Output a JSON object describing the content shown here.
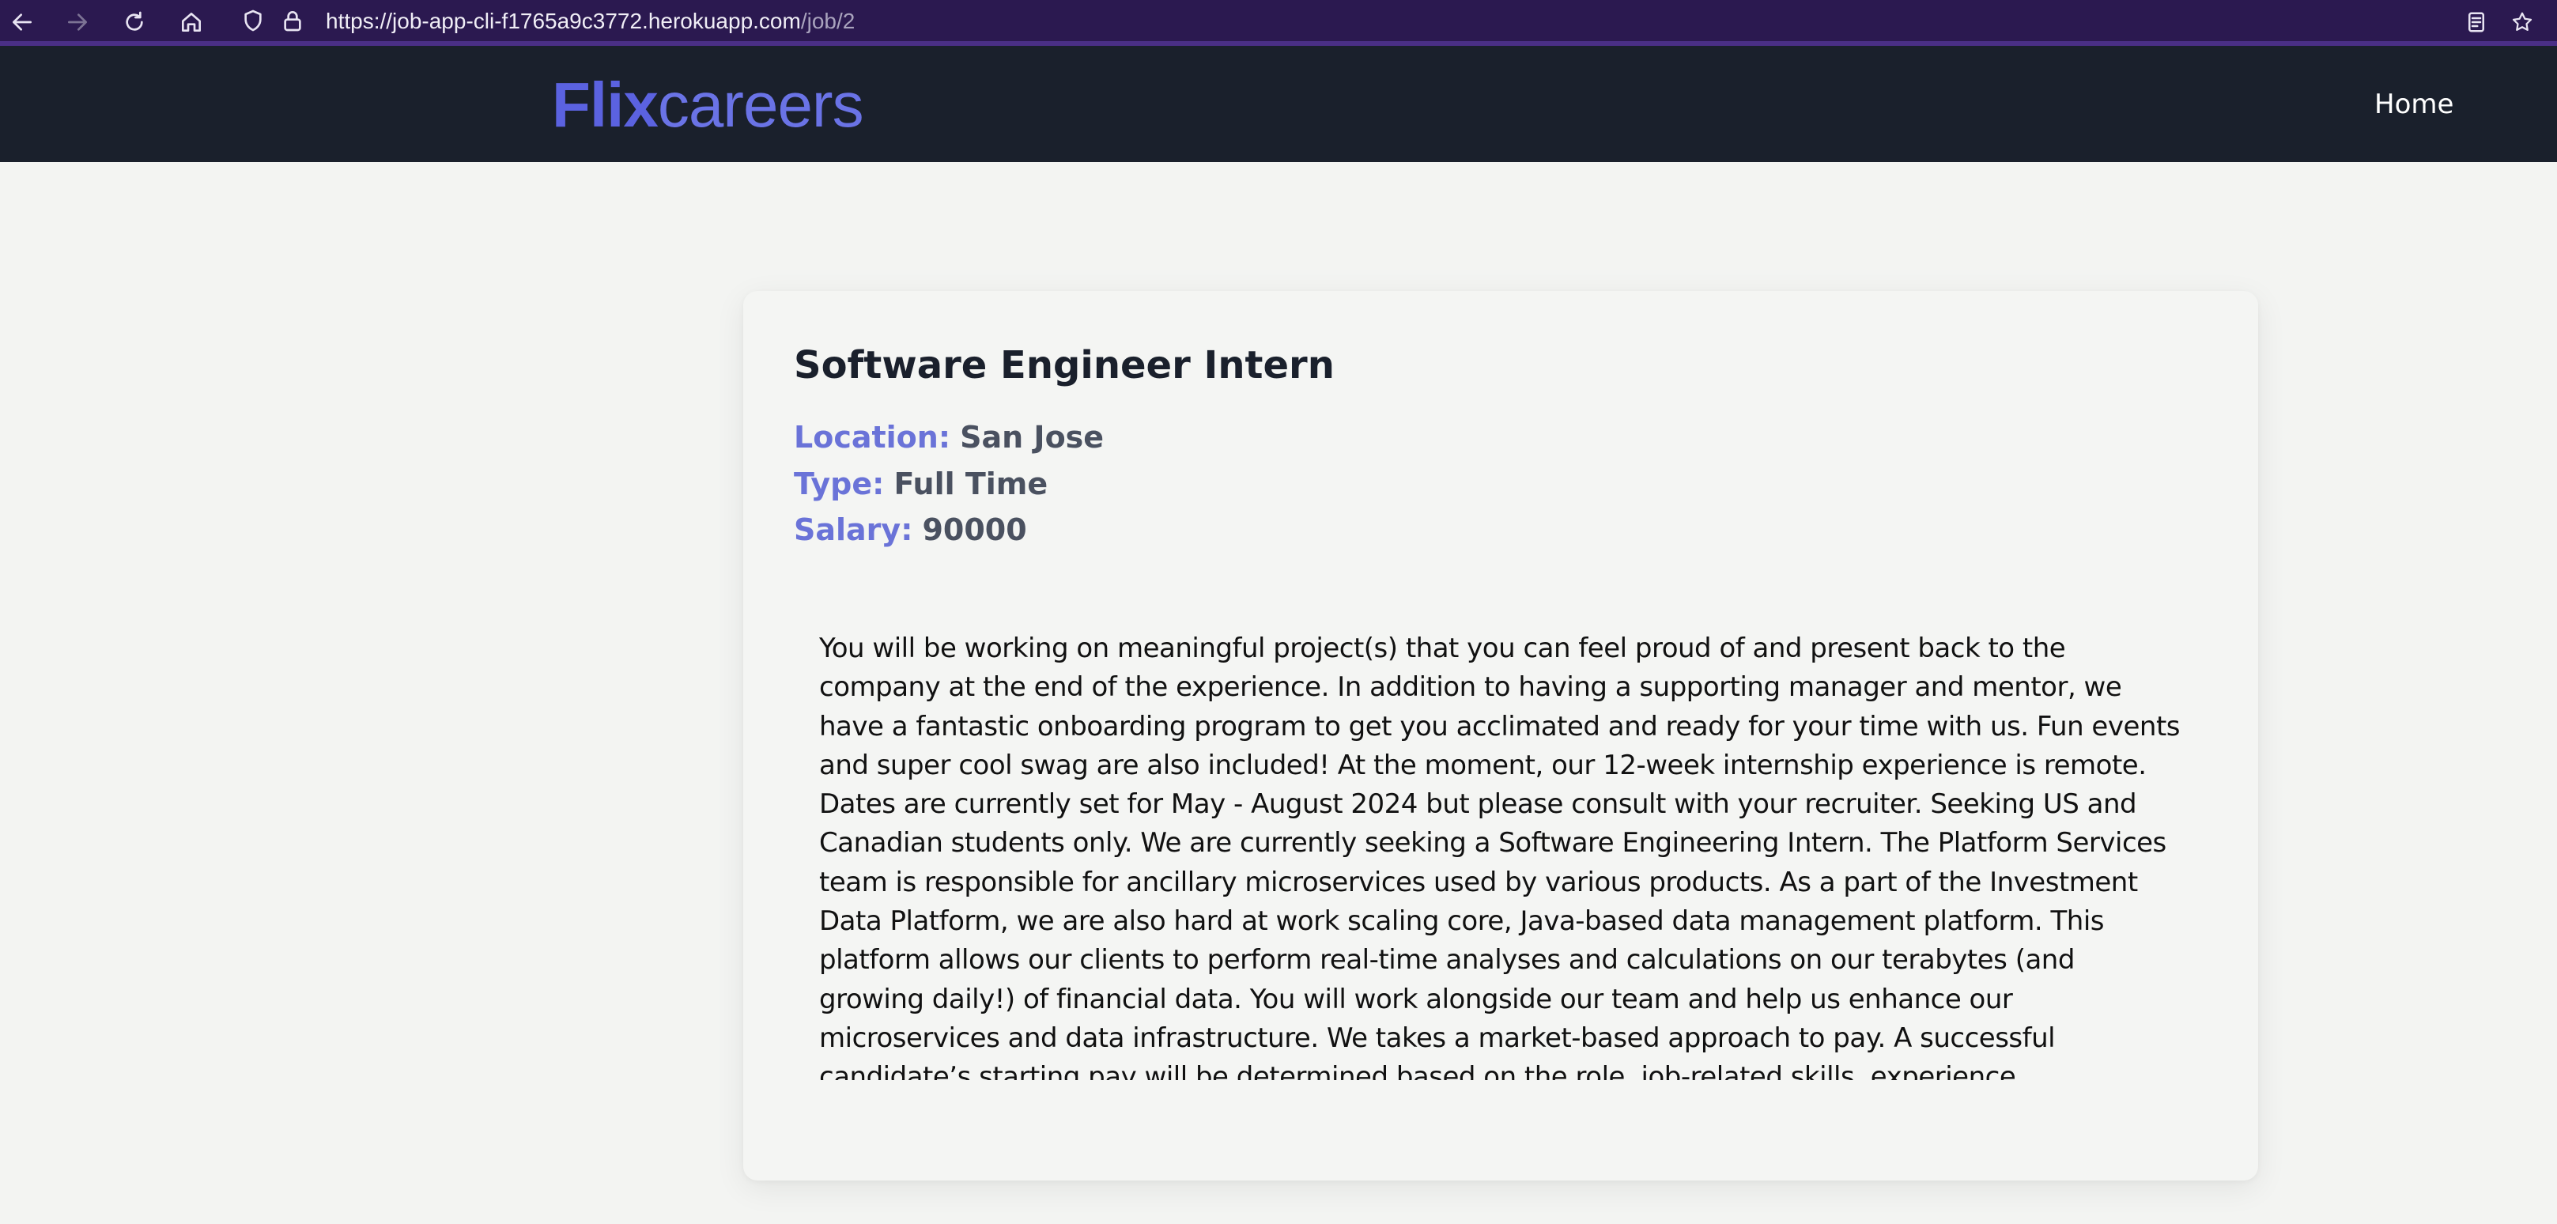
{
  "browser": {
    "url_base": "https://job-app-cli-f1765a9c3772.herokuapp.com",
    "url_path": "/job/2"
  },
  "header": {
    "logo_bold": "Flix",
    "logo_light": "careers",
    "nav_home": "Home"
  },
  "job": {
    "title": "Software Engineer Intern",
    "location_label": "Location:",
    "location": "San Jose",
    "type_label": "Type:",
    "type": "Full Time",
    "salary_label": "Salary:",
    "salary": "90000",
    "description": "You will be working on meaningful project(s) that you can feel proud of and present back to the company at the end of the experience. In addition to having a supporting manager and mentor, we have a fantastic onboarding program to get you acclimated and ready for your time with us. Fun events and super cool swag are also included! At the moment, our 12-week internship experience is remote. Dates are currently set for May - August 2024 but please consult with your recruiter. Seeking US and Canadian students only. We are currently seeking a Software Engineering Intern. The Platform Services team is responsible for ancillary microservices used by various products. As a part of the Investment Data Platform, we are also hard at work scaling core, Java-based data management platform. This platform allows our clients to perform real-time analyses and calculations on our terabytes (and growing daily!) of financial data. You will work alongside our team and help us enhance our microservices and data infrastructure. We takes a market-based approach to pay. A successful candidate’s starting pay will be determined based on the role, job-related skills, experience, qualifications, work location, and market conditions. The range displayed on each job"
  },
  "icons": {
    "back": "arrow-left-icon",
    "forward": "arrow-right-icon",
    "reload": "reload-icon",
    "home": "home-icon",
    "shield": "shield-icon",
    "lock": "lock-icon",
    "reader": "reader-view-icon",
    "bookmark": "star-icon"
  },
  "colors": {
    "browser_bar": "#2b1950",
    "header_bg": "#1a202c",
    "accent": "#5b62e0",
    "label": "#6a73d8",
    "page_bg": "#f3f4f2"
  }
}
